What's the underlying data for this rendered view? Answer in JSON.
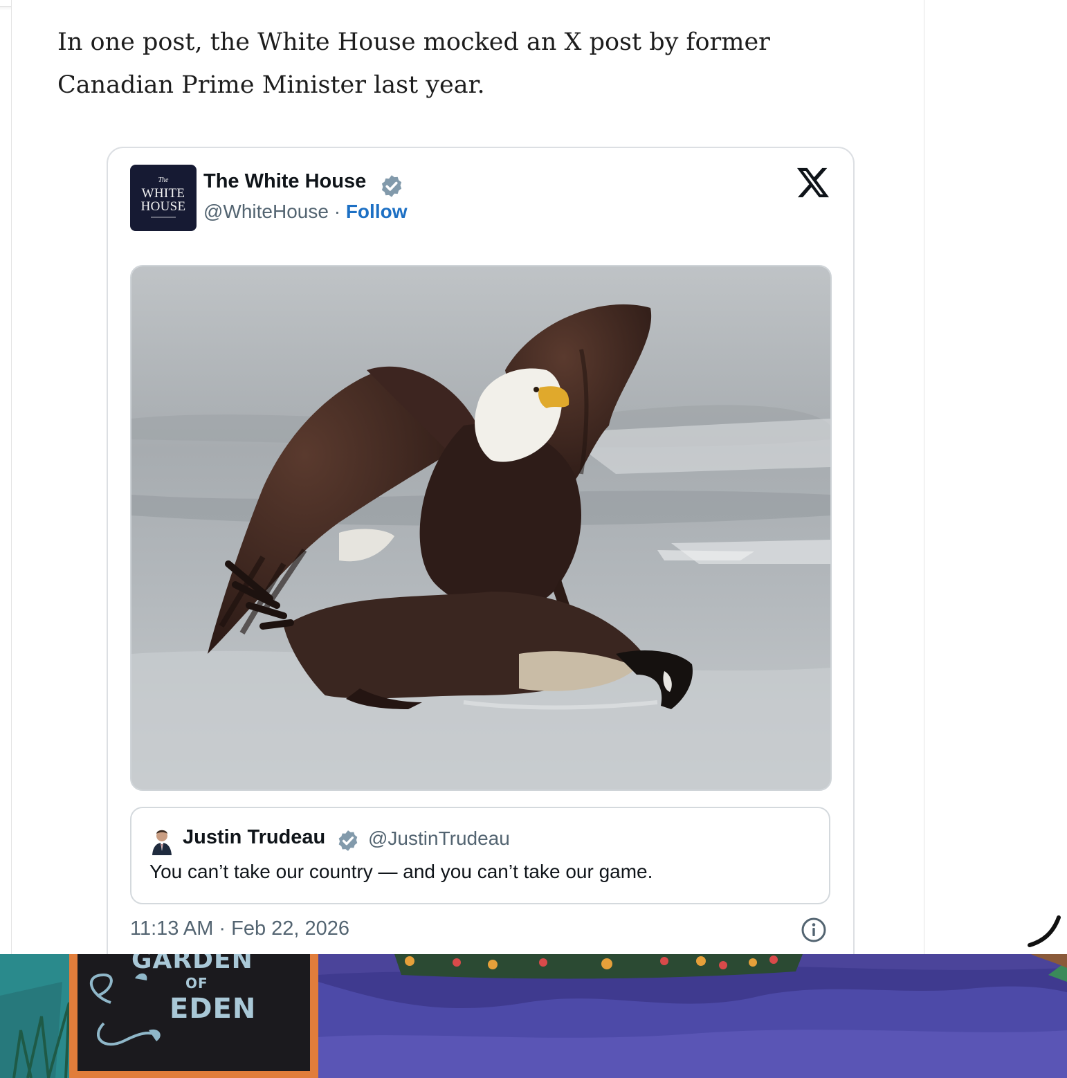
{
  "article": {
    "paragraph": "In one post, the White House mocked an X post by former Canadian Prime Minister last year."
  },
  "tweet": {
    "avatar_lines": [
      "The",
      "WHITE",
      "HOUSE"
    ],
    "author_name": "The White House",
    "handle": "@WhiteHouse",
    "separator": " · ",
    "follow_label": "Follow",
    "platform_icon": "x-logo-icon",
    "photo_icon": "eagle-attacking-goose-photo",
    "quoted": {
      "author_name": "Justin Trudeau",
      "handle": "@JustinTrudeau",
      "text": "You can’t take our country — and you can’t take our game."
    },
    "timestamp": "11:13 AM · Feb 22, 2026",
    "info_icon": "info-icon"
  },
  "mural": {
    "sign_words": [
      "GARDEN",
      "OF",
      "EDEN"
    ]
  },
  "colors": {
    "follow_link": "#1d70c4",
    "verified_badge": "#829aab",
    "secondary_text": "#536471",
    "avatar_bg": "#161a33",
    "mural_purple": "#4b449a",
    "mural_teal": "#2a8a8c"
  }
}
